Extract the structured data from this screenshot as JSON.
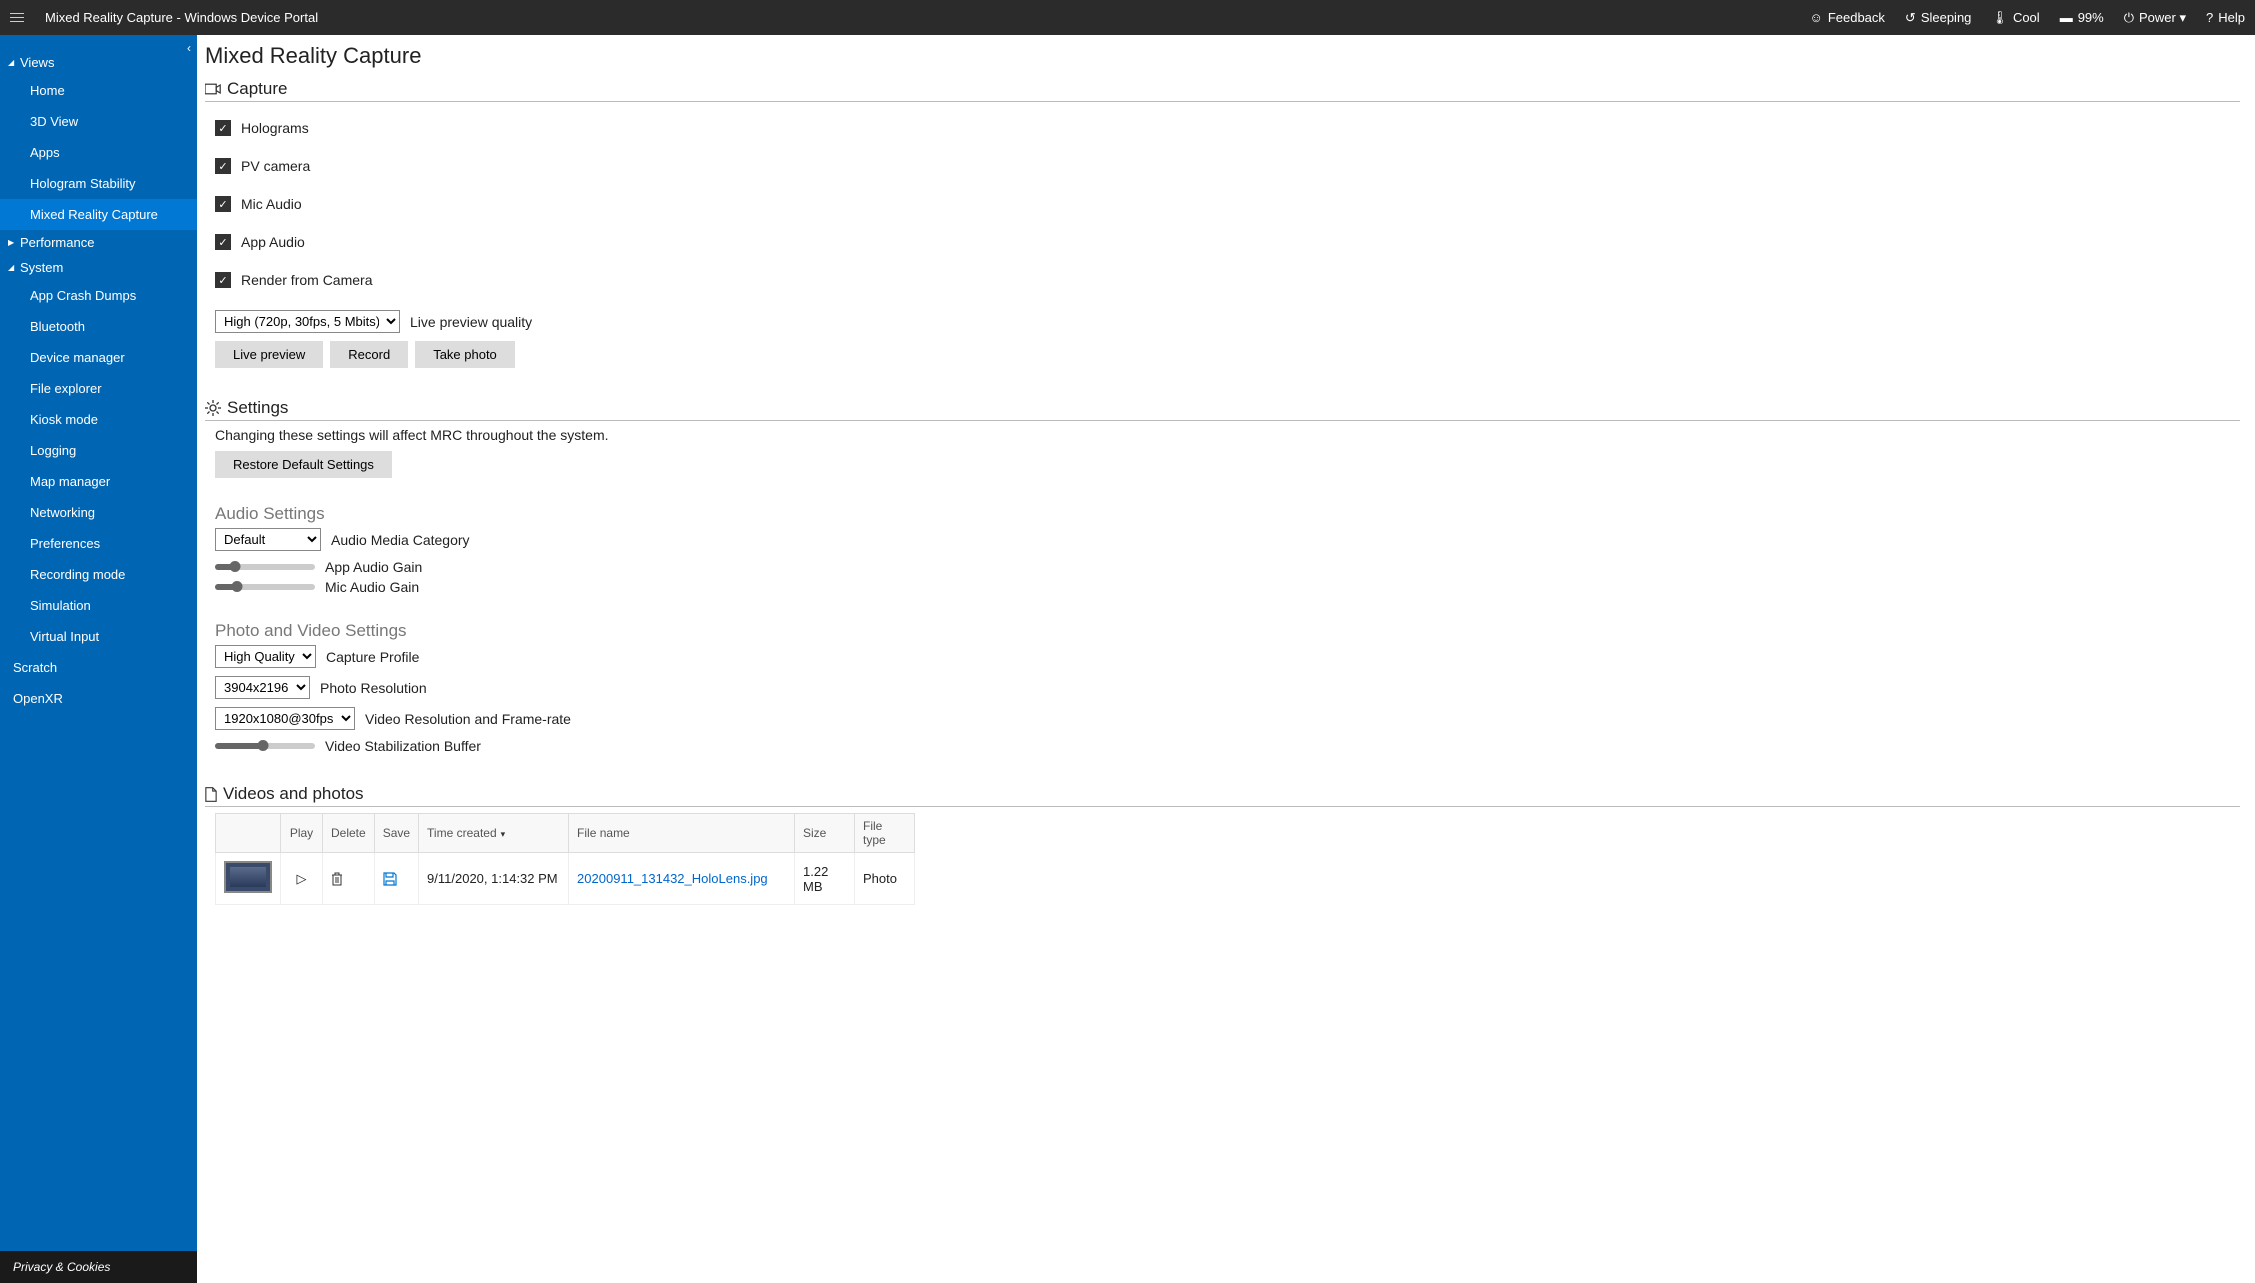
{
  "header": {
    "title": "Mixed Reality Capture - Windows Device Portal",
    "feedback": "Feedback",
    "sleeping": "Sleeping",
    "cool": "Cool",
    "battery": "99%",
    "power": "Power ▾",
    "help": "Help"
  },
  "sidebar": {
    "sections": [
      {
        "label": "Views",
        "expanded": true,
        "items": [
          "Home",
          "3D View",
          "Apps",
          "Hologram Stability",
          "Mixed Reality Capture"
        ],
        "active": 4
      },
      {
        "label": "Performance",
        "expanded": false
      },
      {
        "label": "System",
        "expanded": true,
        "items": [
          "App Crash Dumps",
          "Bluetooth",
          "Device manager",
          "File explorer",
          "Kiosk mode",
          "Logging",
          "Map manager",
          "Networking",
          "Preferences",
          "Recording mode",
          "Simulation",
          "Virtual Input"
        ]
      }
    ],
    "bottom": [
      "Scratch",
      "OpenXR"
    ],
    "footer": "Privacy & Cookies"
  },
  "page": {
    "title": "Mixed Reality Capture",
    "capture": {
      "heading": "Capture",
      "checks": [
        "Holograms",
        "PV camera",
        "Mic Audio",
        "App Audio",
        "Render from Camera"
      ],
      "quality_select": "High (720p, 30fps, 5 Mbits)",
      "quality_label": "Live preview quality",
      "buttons": [
        "Live preview",
        "Record",
        "Take photo"
      ]
    },
    "settings": {
      "heading": "Settings",
      "desc": "Changing these settings will affect MRC throughout the system.",
      "restore": "Restore Default Settings",
      "audio_heading": "Audio Settings",
      "audio_category_select": "Default",
      "audio_category_label": "Audio Media Category",
      "app_gain": "App Audio Gain",
      "mic_gain": "Mic Audio Gain",
      "pv_heading": "Photo and Video Settings",
      "profile_select": "High Quality",
      "profile_label": "Capture Profile",
      "photo_res_select": "3904x2196",
      "photo_res_label": "Photo Resolution",
      "video_res_select": "1920x1080@30fps",
      "video_res_label": "Video Resolution and Frame-rate",
      "stab_label": "Video Stabilization Buffer"
    },
    "videos": {
      "heading": "Videos and photos",
      "cols": {
        "play": "Play",
        "delete": "Delete",
        "save": "Save",
        "time": "Time created",
        "file": "File name",
        "size": "Size",
        "type": "File type"
      },
      "rows": [
        {
          "time": "9/11/2020, 1:14:32 PM",
          "file": "20200911_131432_HoloLens.jpg",
          "size": "1.22 MB",
          "type": "Photo"
        }
      ]
    }
  }
}
